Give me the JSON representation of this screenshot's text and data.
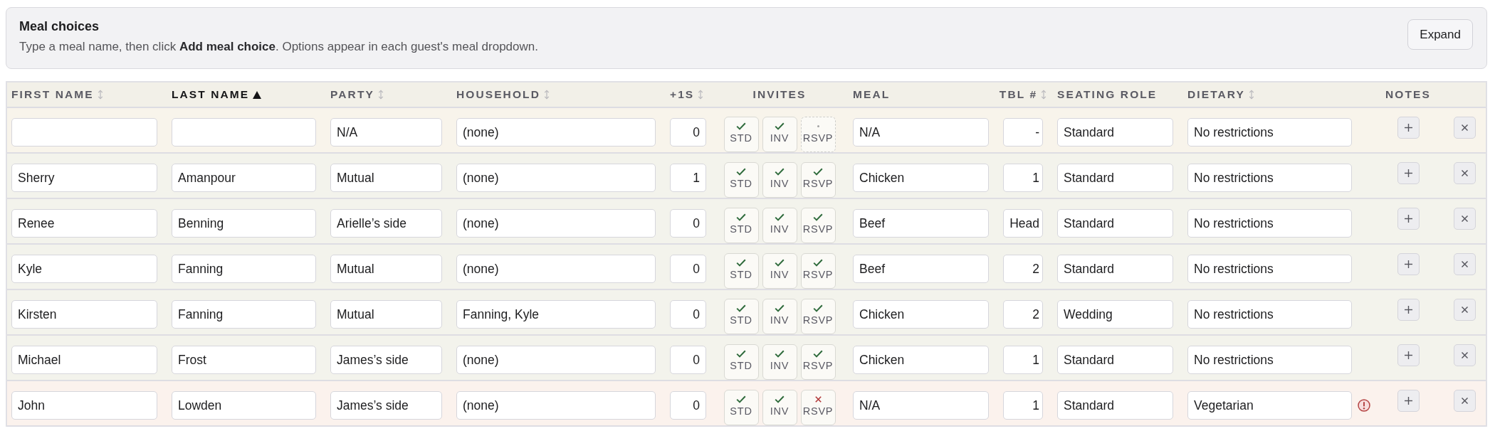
{
  "meal_choices": {
    "title": "Meal choices",
    "description": "Type a meal name, then click **Add meal choice**. Options appear in each guest's meal dropdown.",
    "expand_button": "Expand"
  },
  "table": {
    "columns": [
      {
        "label": "FIRST NAME",
        "sortable": true,
        "sorted": false
      },
      {
        "label": "LAST NAME",
        "sortable": true,
        "sorted": true
      },
      {
        "label": "PARTY",
        "sortable": true,
        "sorted": false
      },
      {
        "label": "HOUSEHOLD",
        "sortable": true,
        "sorted": false
      },
      {
        "label": "+1S",
        "sortable": true,
        "sorted": false
      },
      {
        "label": "INVITES",
        "sortable": false,
        "sorted": false
      },
      {
        "label": "MEAL",
        "sortable": false,
        "sorted": false
      },
      {
        "label": "TBL #",
        "sortable": true,
        "sorted": false
      },
      {
        "label": "SEATING ROLE",
        "sortable": false,
        "sorted": false
      },
      {
        "label": "DIETARY",
        "sortable": true,
        "sorted": false
      },
      {
        "label": "NOTES",
        "sortable": false,
        "sorted": false
      }
    ],
    "rows": [
      {
        "party": "N/A",
        "household": "(none)",
        "plus_ones": "0",
        "invites": [
          {
            "label": "STD",
            "checked": true,
            "declined": false
          },
          {
            "label": "INV",
            "checked": true,
            "declined": false
          },
          {
            "label": "RSVP",
            "checked": false,
            "declined": false
          }
        ],
        "meal": "N/A",
        "table": "-",
        "seating_role": "Standard",
        "dietary": "No restrictions",
        "dietary_warning": false
      },
      {
        "first_name": "Sherry",
        "last_name": "Amanpour",
        "party": "Mutual",
        "household": "(none)",
        "plus_ones": "1",
        "invites": [
          {
            "label": "STD",
            "checked": true,
            "declined": false
          },
          {
            "label": "INV",
            "checked": true,
            "declined": false
          },
          {
            "label": "RSVP",
            "checked": true,
            "declined": false
          }
        ],
        "meal": "Chicken",
        "table": "1",
        "seating_role": "Standard",
        "dietary": "No restrictions",
        "dietary_warning": false
      },
      {
        "first_name": "Renee",
        "last_name": "Benning",
        "party": "Arielle’s side",
        "household": "(none)",
        "plus_ones": "0",
        "invites": [
          {
            "label": "STD",
            "checked": true,
            "declined": false
          },
          {
            "label": "INV",
            "checked": true,
            "declined": false
          },
          {
            "label": "RSVP",
            "checked": true,
            "declined": false
          }
        ],
        "meal": "Beef",
        "table": "Head",
        "seating_role": "Standard",
        "dietary": "No restrictions",
        "dietary_warning": false
      },
      {
        "first_name": "Kyle",
        "last_name": "Fanning",
        "party": "Mutual",
        "household": "(none)",
        "plus_ones": "0",
        "invites": [
          {
            "label": "STD",
            "checked": true,
            "declined": false
          },
          {
            "label": "INV",
            "checked": true,
            "declined": false
          },
          {
            "label": "RSVP",
            "checked": true,
            "declined": false
          }
        ],
        "meal": "Beef",
        "table": "2",
        "seating_role": "Standard",
        "dietary": "No restrictions",
        "dietary_warning": false
      },
      {
        "first_name": "Kirsten",
        "last_name": "Fanning",
        "party": "Mutual",
        "household": "Fanning, Kyle",
        "plus_ones": "0",
        "invites": [
          {
            "label": "STD",
            "checked": true,
            "declined": false
          },
          {
            "label": "INV",
            "checked": true,
            "declined": false
          },
          {
            "label": "RSVP",
            "checked": true,
            "declined": false
          }
        ],
        "meal": "Chicken",
        "table": "2",
        "seating_role": "Wedding",
        "dietary": "No restrictions",
        "dietary_warning": false
      },
      {
        "first_name": "Michael",
        "last_name": "Frost",
        "party": "James’s side",
        "household": "(none)",
        "plus_ones": "0",
        "invites": [
          {
            "label": "STD",
            "checked": true,
            "declined": false
          },
          {
            "label": "INV",
            "checked": true,
            "declined": false
          },
          {
            "label": "RSVP",
            "checked": true,
            "declined": false
          }
        ],
        "meal": "Chicken",
        "table": "1",
        "seating_role": "Standard",
        "dietary": "No restrictions",
        "dietary_warning": false
      },
      {
        "first_name": "John",
        "last_name": "Lowden",
        "party": "James’s side",
        "household": "(none)",
        "plus_ones": "0",
        "invites": [
          {
            "label": "STD",
            "checked": true,
            "declined": false
          },
          {
            "label": "INV",
            "checked": true,
            "declined": false
          },
          {
            "label": "RSVP",
            "checked": false,
            "declined": true
          }
        ],
        "meal": "N/A",
        "table": "1",
        "seating_role": "Standard",
        "dietary": "Vegetarian",
        "dietary_warning": true
      }
    ]
  }
}
